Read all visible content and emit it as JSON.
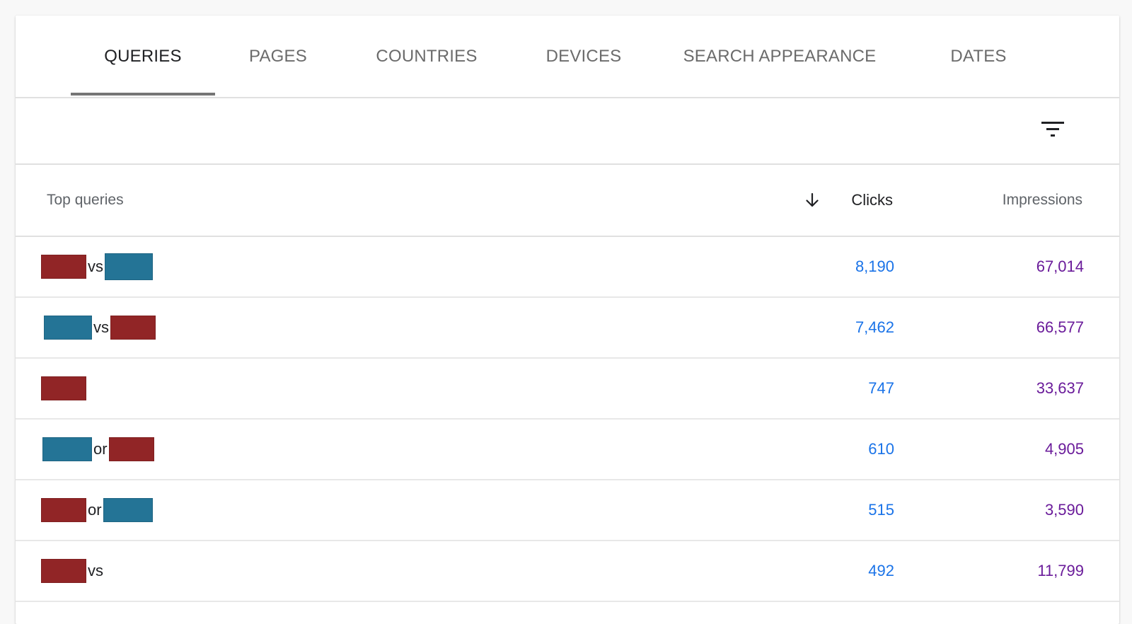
{
  "tabs": [
    {
      "label": "QUERIES",
      "active": true
    },
    {
      "label": "PAGES",
      "active": false
    },
    {
      "label": "COUNTRIES",
      "active": false
    },
    {
      "label": "DEVICES",
      "active": false
    },
    {
      "label": "SEARCH APPEARANCE",
      "active": false
    },
    {
      "label": "DATES",
      "active": false
    }
  ],
  "toolbar": {
    "filter_icon": "filter-list-icon"
  },
  "table": {
    "headers": {
      "queries": "Top queries",
      "clicks": "Clicks",
      "impressions": "Impressions",
      "sort_icon": "arrow-down-icon"
    },
    "rows": [
      {
        "conjunction": "vs",
        "clicks": "8,190",
        "impressions": "67,014"
      },
      {
        "conjunction": "vs",
        "clicks": "7,462",
        "impressions": "66,577"
      },
      {
        "conjunction": "",
        "clicks": "747",
        "impressions": "33,637"
      },
      {
        "conjunction": "or",
        "clicks": "610",
        "impressions": "4,905"
      },
      {
        "conjunction": "or",
        "clicks": "515",
        "impressions": "3,590"
      },
      {
        "conjunction": "vs",
        "clicks": "492",
        "impressions": "11,799"
      }
    ]
  },
  "colors": {
    "redaction_red": "#912526",
    "redaction_blue": "#247496",
    "clicks": "#1a73e8",
    "impressions": "#6a1b9a"
  }
}
